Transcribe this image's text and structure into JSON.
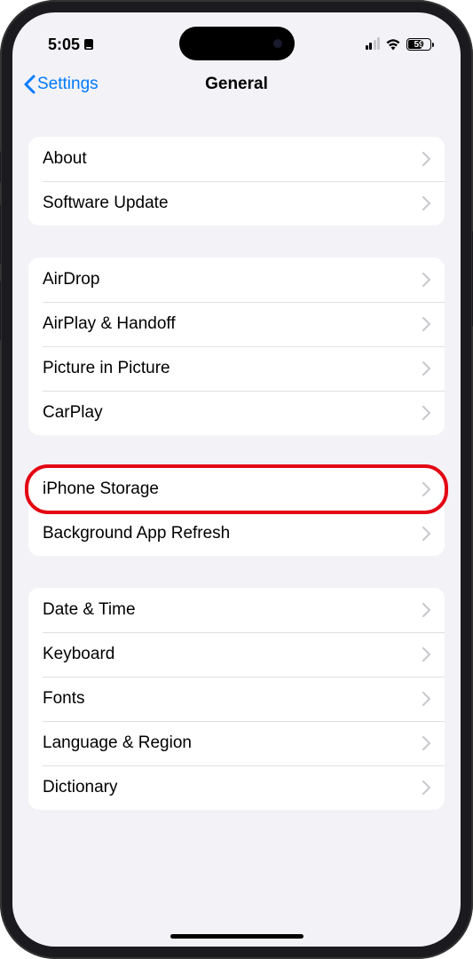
{
  "status": {
    "time": "5:05",
    "battery": "59"
  },
  "nav": {
    "back_label": "Settings",
    "title": "General"
  },
  "sections": [
    {
      "items": [
        {
          "label": "About"
        },
        {
          "label": "Software Update"
        }
      ]
    },
    {
      "items": [
        {
          "label": "AirDrop"
        },
        {
          "label": "AirPlay & Handoff"
        },
        {
          "label": "Picture in Picture"
        },
        {
          "label": "CarPlay"
        }
      ]
    },
    {
      "items": [
        {
          "label": "iPhone Storage",
          "highlighted": true
        },
        {
          "label": "Background App Refresh"
        }
      ]
    },
    {
      "items": [
        {
          "label": "Date & Time"
        },
        {
          "label": "Keyboard"
        },
        {
          "label": "Fonts"
        },
        {
          "label": "Language & Region"
        },
        {
          "label": "Dictionary"
        }
      ]
    }
  ]
}
